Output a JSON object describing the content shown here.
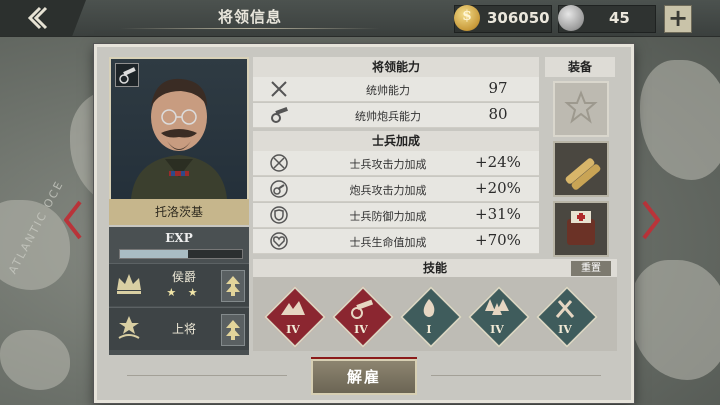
{
  "header": {
    "title": "将领信息"
  },
  "currency": {
    "gold": "306050",
    "medals": "45",
    "gold_symbol": "$"
  },
  "map": {
    "ocean_label": "ATLANTIC OCE"
  },
  "general": {
    "name": "托洛茨基",
    "exp_label": "EXP",
    "exp_progress": 0.56,
    "title_rank": "侯爵",
    "title_stars": "★ ★",
    "military_rank": "上将"
  },
  "abilities": {
    "header": "将领能力",
    "rows": [
      {
        "label": "统帅能力",
        "value": "97",
        "icon": "crossed-swords-icon"
      },
      {
        "label": "统帅炮兵能力",
        "value": "80",
        "icon": "cannon-icon"
      }
    ]
  },
  "soldier_bonus": {
    "header": "士兵加成",
    "rows": [
      {
        "label": "士兵攻击力加成",
        "value": "+24%",
        "icon": "attack-bonus-icon"
      },
      {
        "label": "炮兵攻击力加成",
        "value": "+20%",
        "icon": "artillery-bonus-icon"
      },
      {
        "label": "士兵防御力加成",
        "value": "+31%",
        "icon": "defense-bonus-icon"
      },
      {
        "label": "士兵生命值加成",
        "value": "+70%",
        "icon": "health-bonus-icon"
      }
    ]
  },
  "equipment": {
    "header": "装备"
  },
  "skills": {
    "header": "技能",
    "reset_label": "重置",
    "items": [
      {
        "level": "IV",
        "color": "#8b2630",
        "icon": "cavalry-charge-icon"
      },
      {
        "level": "IV",
        "color": "#8b2630",
        "icon": "artillery-skill-icon"
      },
      {
        "level": "I",
        "color": "#3f5c5c",
        "icon": "fire-skill-icon"
      },
      {
        "level": "IV",
        "color": "#3f5c5c",
        "icon": "forest-skill-icon"
      },
      {
        "level": "IV",
        "color": "#3f5c5c",
        "icon": "tools-skill-icon"
      }
    ]
  },
  "actions": {
    "dismiss_label": "解雇"
  }
}
